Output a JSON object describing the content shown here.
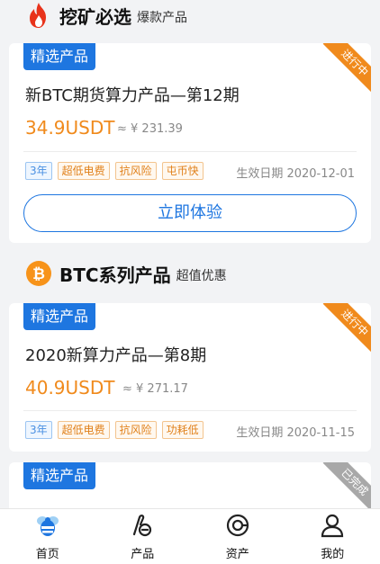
{
  "sections": [
    {
      "title": "挖矿必选",
      "subtitle": "爆款产品",
      "icon": "fire-icon"
    },
    {
      "title": "BTC系列产品",
      "subtitle": "超值优惠",
      "icon": "bitcoin-icon"
    }
  ],
  "cards": [
    {
      "badge": "精选产品",
      "ribbon": "进行中",
      "title": "新BTC期货算力产品—第12期",
      "price": "34.9USDT",
      "approx": "≈ ¥ 231.39",
      "tags": [
        "3年",
        "超低电费",
        "抗风险",
        "屯币快"
      ],
      "date": "生效日期 2020-12-01",
      "cta": "立即体验"
    },
    {
      "badge": "精选产品",
      "ribbon": "进行中",
      "title": "2020新算力产品—第8期",
      "price": "40.9USDT",
      "approx": "≈ ¥ 271.17",
      "tags": [
        "3年",
        "超低电费",
        "抗风险",
        "功耗低"
      ],
      "date": "生效日期 2020-11-15"
    },
    {
      "badge": "精选产品",
      "ribbon": "已完成"
    }
  ],
  "tabbar": [
    {
      "label": "首页",
      "icon": "home-bee-icon"
    },
    {
      "label": "产品",
      "icon": "product-icon"
    },
    {
      "label": "资产",
      "icon": "assets-icon"
    },
    {
      "label": "我的",
      "icon": "user-icon"
    }
  ]
}
